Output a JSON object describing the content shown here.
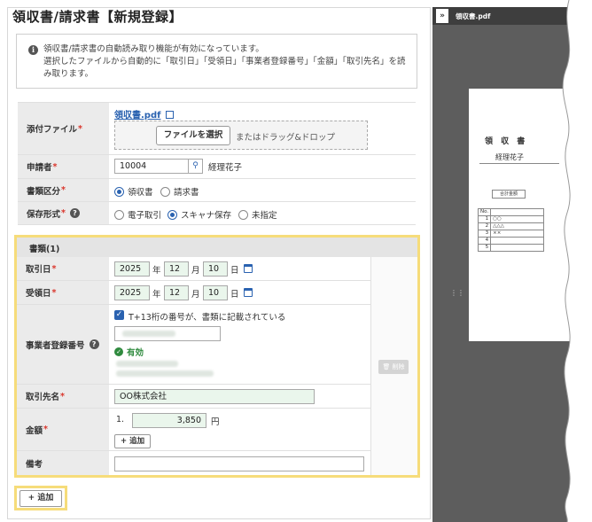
{
  "page": {
    "title": "領収書/請求書【新規登録】"
  },
  "info": {
    "line1": "領収書/請求書の自動読み取り機能が有効になっています。",
    "line2": "選択したファイルから自動的に「取引日」「受領日」「事業者登録番号」「金額」「取引先名」を読",
    "line3": "み取ります。"
  },
  "form": {
    "attachment": {
      "label": "添付ファイル",
      "file_name": "領収書.pdf",
      "choose_button": "ファイルを選択",
      "drop_hint": "またはドラッグ&ドロップ"
    },
    "applicant": {
      "label": "申請者",
      "code": "10004",
      "name": "経理花子"
    },
    "doc_type": {
      "label": "書類区分",
      "options": [
        "領収書",
        "請求書"
      ],
      "selected": "領収書"
    },
    "storage": {
      "label": "保存形式",
      "options": [
        "電子取引",
        "スキャナ保存",
        "未指定"
      ],
      "selected": "スキャナ保存"
    },
    "required_mark": "*"
  },
  "document": {
    "header": "書類(1)",
    "transaction_date": {
      "label": "取引日",
      "year": "2025",
      "month": "12",
      "day": "10"
    },
    "received_date": {
      "label": "受領日",
      "year": "2025",
      "month": "12",
      "day": "10"
    },
    "date_units": {
      "year": "年",
      "month": "月",
      "day": "日"
    },
    "registration": {
      "label": "事業者登録番号",
      "checkbox_label": "T+13桁の番号が、書類に記載されている",
      "status": "有効"
    },
    "partner": {
      "label": "取引先名",
      "value": "OO株式会社"
    },
    "amount": {
      "label": "金額",
      "index": "1.",
      "value": "3,850",
      "unit": "円",
      "add_label": "追加"
    },
    "remarks": {
      "label": "備考",
      "value": ""
    },
    "delete_label": "削除"
  },
  "footer": {
    "add_label": "追加"
  },
  "viewer": {
    "file_name": "領収書.pdf",
    "collapse_glyph": "»",
    "receipt": {
      "title": "領 収 書",
      "recipient": "経理花子",
      "total_label": "合計金額",
      "table_header": "No.",
      "rows": [
        {
          "no": "1",
          "item": "○○"
        },
        {
          "no": "2",
          "item": "△△△"
        },
        {
          "no": "3",
          "item": "××"
        },
        {
          "no": "4",
          "item": ""
        },
        {
          "no": "5",
          "item": ""
        }
      ]
    }
  },
  "colors": {
    "accent": "#2a62b0",
    "required": "#d9352b",
    "highlight": "#f6dc7a",
    "valid": "#2f8a3e"
  }
}
